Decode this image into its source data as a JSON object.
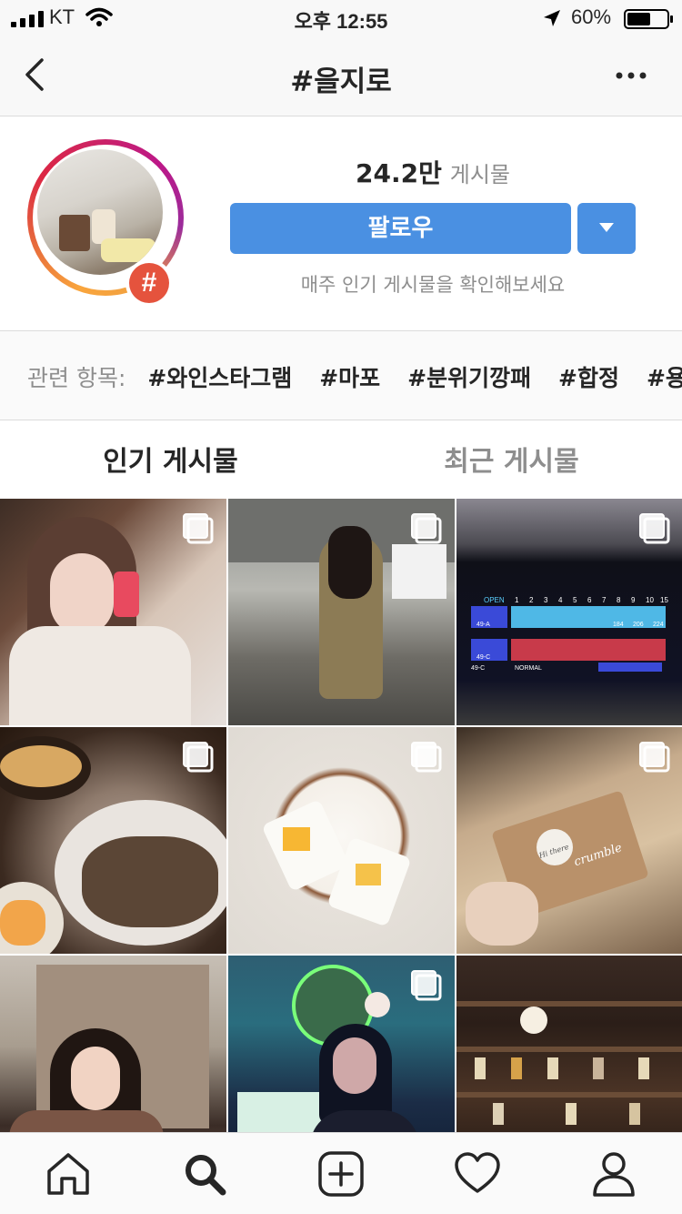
{
  "status_bar": {
    "carrier": "KT",
    "time": "오후 12:55",
    "battery_percent": "60%",
    "battery_level": 0.6,
    "icons": [
      "signal-icon",
      "wifi-icon",
      "location-arrow-icon",
      "battery-icon"
    ]
  },
  "nav": {
    "title": "#을지로",
    "icons": [
      "back-chevron-icon",
      "more-options-icon"
    ]
  },
  "header": {
    "posts_count": "24.2만",
    "posts_label": "게시물",
    "follow_label": "팔로우",
    "weekly_text": "매주 인기 게시물을 확인해보세요",
    "badge": "#"
  },
  "related": {
    "label": "관련 항목:",
    "tags": [
      "#와인스타그램",
      "#마포",
      "#분위기깡패",
      "#합정",
      "#용산"
    ]
  },
  "tabs": {
    "top_posts": "인기 게시물",
    "recent_posts": "최근 게시물"
  },
  "grid": {
    "posts": [
      {
        "desc": "woman selfie",
        "multi": true
      },
      {
        "desc": "woman walking street",
        "multi": true
      },
      {
        "desc": "bowling scoreboard",
        "multi": true
      },
      {
        "desc": "sundae platter",
        "multi": true
      },
      {
        "desc": "fruit sandwich plate",
        "multi": true
      },
      {
        "desc": "crumble box",
        "multi": true
      },
      {
        "desc": "woman portrait",
        "multi": false
      },
      {
        "desc": "woman neon arcade",
        "multi": true
      },
      {
        "desc": "bookshelf",
        "multi": false
      }
    ],
    "scoreboard": {
      "open": "OPEN",
      "frames": [
        "1",
        "2",
        "3",
        "4",
        "5",
        "6",
        "7",
        "8",
        "9",
        "10",
        "15"
      ],
      "score1": "49-A",
      "score2": "49-C",
      "normal": "NORMAL",
      "totals": [
        "184",
        "206",
        "224"
      ]
    },
    "crumble_text": "crumble",
    "crumble_text2": "Hi there"
  },
  "tab_bar": {
    "items": [
      "home-icon",
      "search-icon",
      "add-post-icon",
      "activity-heart-icon",
      "profile-icon"
    ],
    "active": "search-icon"
  }
}
